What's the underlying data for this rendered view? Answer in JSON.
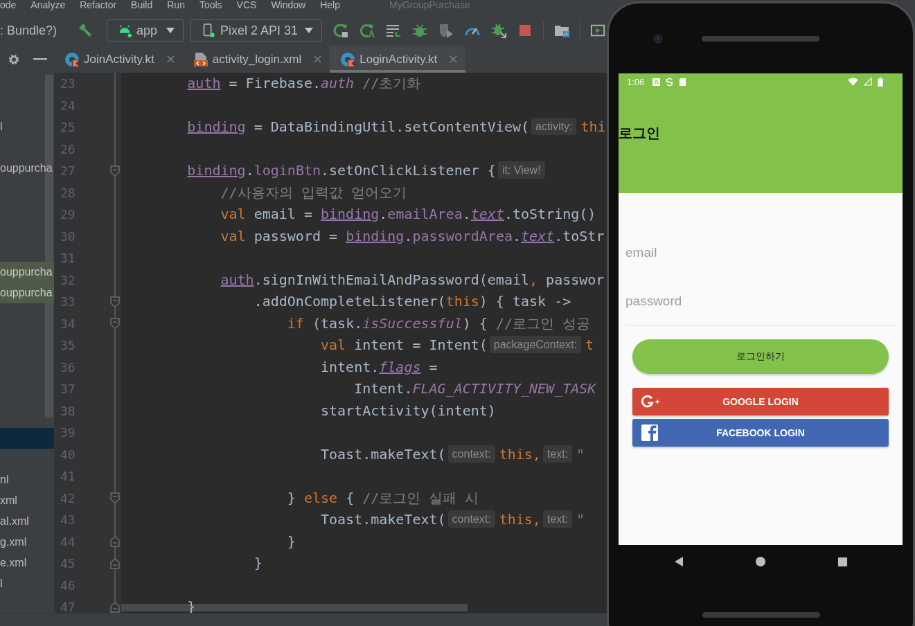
{
  "menu_bar": {
    "items": [
      "ode",
      "Analyze",
      "Refactor",
      "Build",
      "Run",
      "Tools",
      "VCS",
      "Window",
      "Help"
    ],
    "project_title": "MyGroupPurchase"
  },
  "toolbar": {
    "breadcrumb": ": Bundle?)",
    "run_config": "app",
    "device": "Pixel 2 API 31"
  },
  "editor_tabs": [
    {
      "label": "JoinActivity.kt",
      "kind": "kotlin",
      "selected": false
    },
    {
      "label": "activity_login.xml",
      "kind": "xml",
      "selected": false
    },
    {
      "label": "LoginActivity.kt",
      "kind": "kotlin",
      "selected": true
    }
  ],
  "project_tree": {
    "rows": [
      {},
      {},
      {
        "text": "l",
        "selected": false,
        "highlighted": false
      },
      {},
      {
        "text": "ouppurcha",
        "selected": false,
        "highlighted": false
      },
      {},
      {},
      {},
      {},
      {
        "text": "ouppurcha",
        "selected": false,
        "highlighted": true
      },
      {
        "text": "ouppurcha",
        "selected": false,
        "highlighted": true
      },
      {},
      {},
      {},
      {},
      {},
      {},
      {
        "selected": true,
        "highlighted": false
      },
      {},
      {
        "text": "nl",
        "selected": false,
        "highlighted": false
      },
      {
        "text": "xml",
        "selected": false,
        "highlighted": false
      },
      {
        "text": "al.xml",
        "selected": false,
        "highlighted": false
      },
      {
        "text": "g.xml",
        "selected": false,
        "highlighted": false
      },
      {
        "text": "e.xml",
        "selected": false,
        "highlighted": false
      },
      {
        "text": "l",
        "selected": false,
        "highlighted": false
      }
    ]
  },
  "editor": {
    "lines": [
      {
        "number": "23",
        "kind": "plain",
        "segments": [
          {
            "kind": "code",
            "tokens": [
              {
                "kind": "var",
                "text": "        auth"
              },
              {
                "kind": "plain",
                "text": " = Firebase."
              },
              {
                "kind": "static",
                "text": "auth"
              },
              {
                "kind": "comment",
                "text": " //초기화"
              }
            ]
          }
        ]
      },
      {
        "number": "24",
        "kind": "plain"
      },
      {
        "number": "25",
        "kind": "plain",
        "segments": [
          {
            "kind": "code",
            "tokens": [
              {
                "kind": "var",
                "text": "        binding"
              },
              {
                "kind": "plain",
                "text": " = DataBindingUtil.setContentView("
              }
            ]
          },
          {
            "kind": "hint",
            "text": "activity:"
          },
          {
            "kind": "code",
            "tokens": [
              {
                "kind": "keyword",
                "text": "thi"
              }
            ]
          }
        ]
      },
      {
        "number": "26",
        "kind": "plain"
      },
      {
        "number": "27",
        "kind": "open",
        "segments": [
          {
            "kind": "code",
            "tokens": [
              {
                "kind": "var",
                "text": "        binding"
              },
              {
                "kind": "plain",
                "text": "."
              },
              {
                "kind": "member",
                "text": "loginBtn"
              },
              {
                "kind": "plain",
                "text": ".setOnClickListener {"
              }
            ]
          },
          {
            "kind": "hint",
            "text": "it: View!"
          }
        ]
      },
      {
        "number": "28",
        "kind": "plain",
        "segments": [
          {
            "kind": "code",
            "tokens": [
              {
                "kind": "comment",
                "text": "            //사용자의 입력값 얻어오기"
              }
            ]
          }
        ]
      },
      {
        "number": "29",
        "kind": "plain",
        "segments": [
          {
            "kind": "code",
            "tokens": [
              {
                "kind": "keyword",
                "text": "            val"
              },
              {
                "kind": "plain",
                "text": " email = "
              },
              {
                "kind": "var",
                "text": "binding"
              },
              {
                "kind": "plain",
                "text": "."
              },
              {
                "kind": "member",
                "text": "emailArea"
              },
              {
                "kind": "plain",
                "text": "."
              },
              {
                "kind": "ext",
                "text": "text"
              },
              {
                "kind": "plain",
                "text": ".toString()"
              }
            ]
          }
        ]
      },
      {
        "number": "30",
        "kind": "plain",
        "segments": [
          {
            "kind": "code",
            "tokens": [
              {
                "kind": "keyword",
                "text": "            val"
              },
              {
                "kind": "plain",
                "text": " password = "
              },
              {
                "kind": "var",
                "text": "binding"
              },
              {
                "kind": "plain",
                "text": "."
              },
              {
                "kind": "member",
                "text": "passwordArea"
              },
              {
                "kind": "plain",
                "text": "."
              },
              {
                "kind": "ext",
                "text": "text"
              },
              {
                "kind": "plain",
                "text": ".toStr"
              }
            ]
          }
        ]
      },
      {
        "number": "31",
        "kind": "plain"
      },
      {
        "number": "32",
        "kind": "plain",
        "segments": [
          {
            "kind": "code",
            "tokens": [
              {
                "kind": "var",
                "text": "            auth"
              },
              {
                "kind": "plain",
                "text": ".signInWithEmailAndPassword(email"
              },
              {
                "kind": "keyword",
                "text": ","
              },
              {
                "kind": "plain",
                "text": " passwor"
              }
            ]
          }
        ]
      },
      {
        "number": "33",
        "kind": "open",
        "segments": [
          {
            "kind": "code",
            "tokens": [
              {
                "kind": "plain",
                "text": "                .addOnCompleteListener("
              },
              {
                "kind": "keyword",
                "text": "this"
              },
              {
                "kind": "plain",
                "text": ") { task ->"
              }
            ]
          }
        ]
      },
      {
        "number": "34",
        "kind": "open",
        "segments": [
          {
            "kind": "code",
            "tokens": [
              {
                "kind": "keyword",
                "text": "                    if"
              },
              {
                "kind": "plain",
                "text": " (task."
              },
              {
                "kind": "static",
                "text": "isSuccessful"
              },
              {
                "kind": "plain",
                "text": ") { "
              },
              {
                "kind": "comment",
                "text": "//로그인 성공"
              }
            ]
          }
        ]
      },
      {
        "number": "35",
        "kind": "plain",
        "segments": [
          {
            "kind": "code",
            "tokens": [
              {
                "kind": "keyword",
                "text": "                        val"
              },
              {
                "kind": "plain",
                "text": " intent = Intent("
              }
            ]
          },
          {
            "kind": "hint",
            "text": "packageContext:"
          },
          {
            "kind": "code",
            "tokens": [
              {
                "kind": "keyword",
                "text": "t"
              }
            ]
          }
        ]
      },
      {
        "number": "36",
        "kind": "plain",
        "segments": [
          {
            "kind": "code",
            "tokens": [
              {
                "kind": "plain",
                "text": "                        intent."
              },
              {
                "kind": "ext",
                "text": "flags"
              },
              {
                "kind": "plain",
                "text": " ="
              }
            ]
          }
        ]
      },
      {
        "number": "37",
        "kind": "plain",
        "segments": [
          {
            "kind": "code",
            "tokens": [
              {
                "kind": "plain",
                "text": "                            Intent."
              },
              {
                "kind": "static",
                "text": "FLAG_ACTIVITY_NEW_TASK"
              }
            ]
          }
        ]
      },
      {
        "number": "38",
        "kind": "plain",
        "segments": [
          {
            "kind": "code",
            "tokens": [
              {
                "kind": "plain",
                "text": "                        startActivity(intent)"
              }
            ]
          }
        ]
      },
      {
        "number": "39",
        "kind": "plain"
      },
      {
        "number": "40",
        "kind": "plain",
        "segments": [
          {
            "kind": "code",
            "tokens": [
              {
                "kind": "plain",
                "text": "                        Toast.makeText("
              }
            ]
          },
          {
            "kind": "hint",
            "text": "context:"
          },
          {
            "kind": "code",
            "tokens": [
              {
                "kind": "keyword",
                "text": "this,"
              }
            ]
          },
          {
            "kind": "hint",
            "text": "text:"
          },
          {
            "kind": "code",
            "tokens": [
              {
                "kind": "string",
                "text": "\""
              }
            ]
          }
        ]
      },
      {
        "number": "41",
        "kind": "plain"
      },
      {
        "number": "42",
        "kind": "open",
        "segments": [
          {
            "kind": "code",
            "tokens": [
              {
                "kind": "plain",
                "text": "                    }"
              },
              {
                "kind": "keyword",
                "text": " else"
              },
              {
                "kind": "plain",
                "text": " { "
              },
              {
                "kind": "comment",
                "text": "//로그인 실패 시"
              }
            ]
          }
        ]
      },
      {
        "number": "43",
        "kind": "plain",
        "segments": [
          {
            "kind": "code",
            "tokens": [
              {
                "kind": "plain",
                "text": "                        Toast.makeText("
              }
            ]
          },
          {
            "kind": "hint",
            "text": "context:"
          },
          {
            "kind": "code",
            "tokens": [
              {
                "kind": "keyword",
                "text": "this,"
              }
            ]
          },
          {
            "kind": "hint",
            "text": "text:"
          },
          {
            "kind": "code",
            "tokens": [
              {
                "kind": "string",
                "text": "\""
              }
            ]
          }
        ]
      },
      {
        "number": "44",
        "kind": "close",
        "segments": [
          {
            "kind": "code",
            "tokens": [
              {
                "kind": "plain",
                "text": "                    }"
              }
            ]
          }
        ]
      },
      {
        "number": "45",
        "kind": "close",
        "segments": [
          {
            "kind": "code",
            "tokens": [
              {
                "kind": "plain",
                "text": "                }"
              }
            ]
          }
        ]
      },
      {
        "number": "46",
        "kind": "plain"
      },
      {
        "number": "47",
        "kind": "close",
        "segments": [
          {
            "kind": "code",
            "tokens": [
              {
                "kind": "plain",
                "text": "        }"
              }
            ]
          }
        ]
      }
    ]
  },
  "emulator": {
    "status_bar": {
      "time": "1:06",
      "badge": "A"
    },
    "app_bar": {
      "title": "로그인"
    },
    "fields": [
      {
        "placeholder": "email",
        "underline": false
      },
      {
        "placeholder": "password",
        "underline": true
      }
    ],
    "login_button": "로그인하기",
    "social_buttons": [
      {
        "kind": "google",
        "label": "GOOGLE LOGIN"
      },
      {
        "kind": "facebook",
        "label": "FACEBOOK LOGIN"
      }
    ]
  }
}
